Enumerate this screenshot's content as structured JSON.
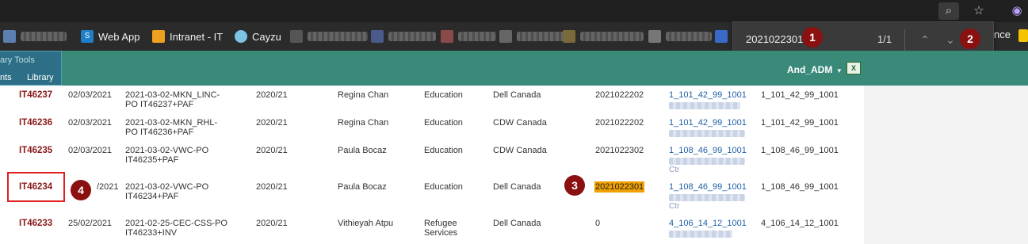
{
  "titlebar": {
    "icons": [
      "search-page-icon",
      "favorites-add-icon",
      "profile-icon"
    ]
  },
  "bookmarks": {
    "items": [
      {
        "label": "Web App",
        "icon": "sharepoint-icon",
        "color": "#1e7fc8"
      },
      {
        "label": "Intranet - IT",
        "icon": "intranet-icon",
        "color": "#f0a020"
      },
      {
        "label": "Cayzu",
        "icon": "cloud-icon",
        "color": "#7cc4e4"
      }
    ],
    "right_text": "nce"
  },
  "findbar": {
    "query": "2021022301",
    "count": "1/1",
    "prev_icon": "chevron-up-icon",
    "next_icon": "chevron-down-icon"
  },
  "app": {
    "ribbon": {
      "title": "ary Tools",
      "tabs": [
        "nts",
        "Library"
      ]
    },
    "user": "And_ADM",
    "user_caret": "▾"
  },
  "table": {
    "rows": [
      {
        "id": "IT46237",
        "date": "02/03/2021",
        "doc1": "2021-03-02-MKN_LINC-",
        "doc2": "PO IT46237+PAF",
        "fy": "2020/21",
        "person": "Regina Chan",
        "dept1": "Education",
        "dept2": "",
        "vendor": "Dell Canada",
        "ref": "2021022202",
        "link": "1_101_42_99_1001",
        "code": "1_101_42_99_1001",
        "extra": ""
      },
      {
        "id": "IT46236",
        "date": "02/03/2021",
        "doc1": "2021-03-02-MKN_RHL-",
        "doc2": "PO IT46236+PAF",
        "fy": "2020/21",
        "person": "Regina Chan",
        "dept1": "Education",
        "dept2": "",
        "vendor": "CDW Canada",
        "ref": "2021022202",
        "link": "1_101_42_99_1001",
        "code": "1_101_42_99_1001",
        "extra": ""
      },
      {
        "id": "IT46235",
        "date": "02/03/2021",
        "doc1": "2021-03-02-VWC-PO",
        "doc2": "IT46235+PAF",
        "fy": "2020/21",
        "person": "Paula Bocaz",
        "dept1": "Education",
        "dept2": "",
        "vendor": "CDW Canada",
        "ref": "2021022302",
        "link": "1_108_46_99_1001",
        "code": "1_108_46_99_1001",
        "extra": "Ctr"
      },
      {
        "id": "IT46234",
        "date": "/2021",
        "doc1": "2021-03-02-VWC-PO",
        "doc2": "IT46234+PAF",
        "fy": "2020/21",
        "person": "Paula Bocaz",
        "dept1": "Education",
        "dept2": "",
        "vendor": "Dell Canada",
        "ref": "2021022301",
        "link": "1_108_46_99_1001",
        "code": "1_108_46_99_1001",
        "extra": "Ctr"
      },
      {
        "id": "IT46233",
        "date": "25/02/2021",
        "doc1": "2021-02-25-CEC-CSS-PO",
        "doc2": "IT46233+INV",
        "fy": "2020/21",
        "person": "Vithieyah Atpu",
        "dept1": "Refugee",
        "dept2": "Services",
        "vendor": "Dell Canada",
        "ref": "0",
        "link": "4_106_14_12_1001",
        "code": "4_106_14_12_1001",
        "extra": ""
      }
    ]
  },
  "callouts": [
    "1",
    "2",
    "3",
    "4"
  ],
  "colors": {
    "highlight": "#f0a000",
    "callout": "#8b1010",
    "header": "#3a8a7a",
    "id_text": "#8b1a1a"
  }
}
